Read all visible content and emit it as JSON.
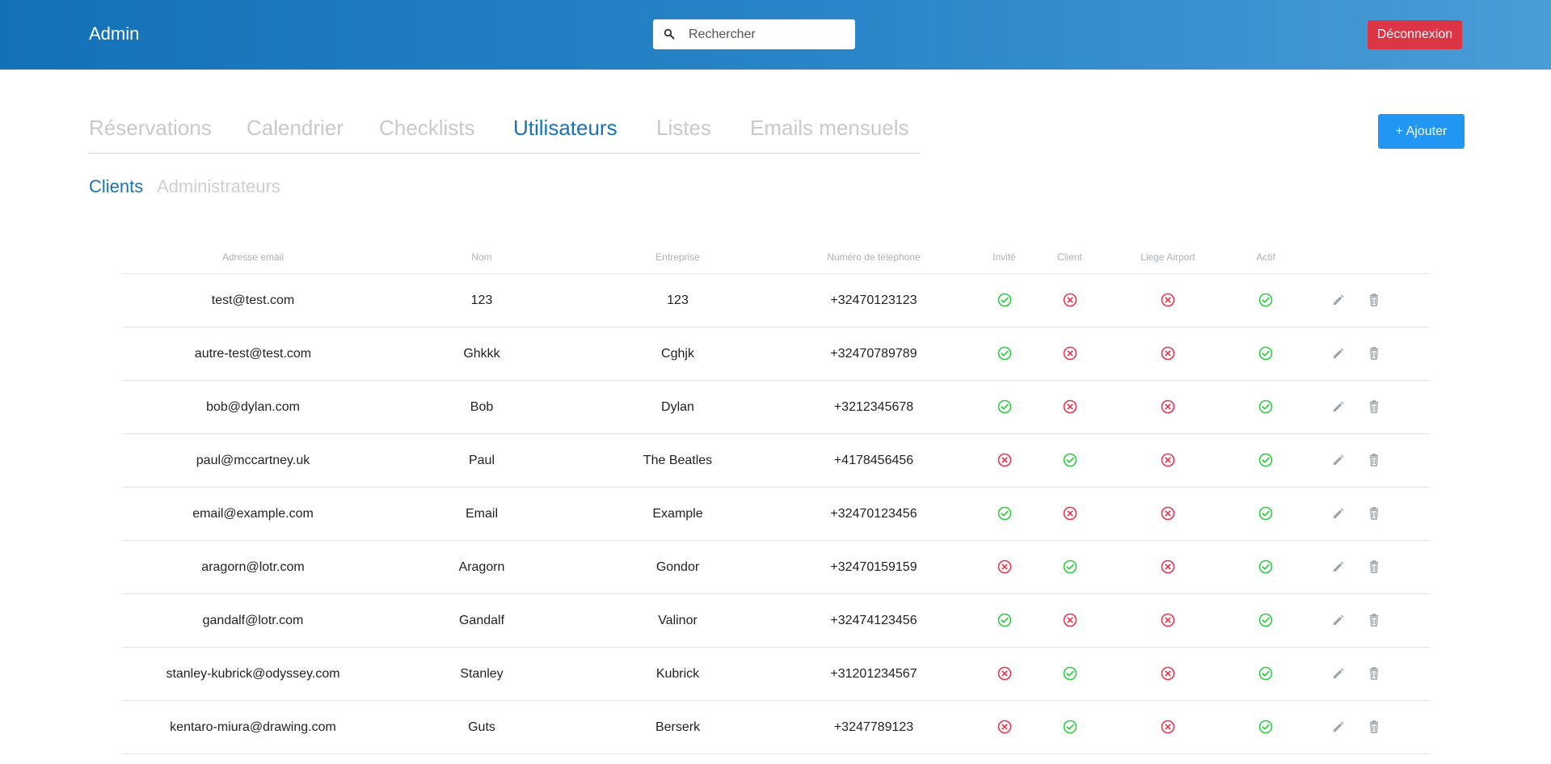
{
  "header": {
    "title": "Admin",
    "search_placeholder": "Rechercher",
    "search_value": "",
    "logout_label": "Déconnexion"
  },
  "tabs": [
    {
      "label": "Réservations",
      "active": false
    },
    {
      "label": "Calendrier",
      "active": false
    },
    {
      "label": "Checklists",
      "active": false
    },
    {
      "label": "Utilisateurs",
      "active": true
    },
    {
      "label": "Listes",
      "active": false
    },
    {
      "label": "Emails mensuels",
      "active": false
    }
  ],
  "add_button": {
    "label": "+ Ajouter"
  },
  "subtabs": [
    {
      "label": "Clients",
      "active": true
    },
    {
      "label": "Administrateurs",
      "active": false
    }
  ],
  "colors": {
    "accent": "#1a73b7",
    "check": "#2ecc40",
    "cross": "#e8344e",
    "danger": "#dc3545",
    "primary": "#2196f3"
  },
  "icons": {
    "yes": "check-circle-icon",
    "no": "x-circle-icon",
    "edit": "pencil-icon",
    "delete": "trash-icon",
    "search": "search-icon"
  },
  "table": {
    "columns": [
      "Adresse email",
      "Nom",
      "Entreprise",
      "Numéro de téléphone",
      "Invité",
      "Client",
      "Liege Airport",
      "Actif"
    ],
    "rows": [
      {
        "email": "test@test.com",
        "nom": "123",
        "entreprise": "123",
        "telephone": "+32470123123",
        "invite": true,
        "client": false,
        "liege_airport": false,
        "actif": true
      },
      {
        "email": "autre-test@test.com",
        "nom": "Ghkkk",
        "entreprise": "Cghjk",
        "telephone": "+32470789789",
        "invite": true,
        "client": false,
        "liege_airport": false,
        "actif": true
      },
      {
        "email": "bob@dylan.com",
        "nom": "Bob",
        "entreprise": "Dylan",
        "telephone": "+3212345678",
        "invite": true,
        "client": false,
        "liege_airport": false,
        "actif": true
      },
      {
        "email": "paul@mccartney.uk",
        "nom": "Paul",
        "entreprise": "The Beatles",
        "telephone": "+4178456456",
        "invite": false,
        "client": true,
        "liege_airport": false,
        "actif": true
      },
      {
        "email": "email@example.com",
        "nom": "Email",
        "entreprise": "Example",
        "telephone": "+32470123456",
        "invite": true,
        "client": false,
        "liege_airport": false,
        "actif": true
      },
      {
        "email": "aragorn@lotr.com",
        "nom": "Aragorn",
        "entreprise": "Gondor",
        "telephone": "+32470159159",
        "invite": false,
        "client": true,
        "liege_airport": false,
        "actif": true
      },
      {
        "email": "gandalf@lotr.com",
        "nom": "Gandalf",
        "entreprise": "Valinor",
        "telephone": "+32474123456",
        "invite": true,
        "client": false,
        "liege_airport": false,
        "actif": true
      },
      {
        "email": "stanley-kubrick@odyssey.com",
        "nom": "Stanley",
        "entreprise": "Kubrick",
        "telephone": "+31201234567",
        "invite": false,
        "client": true,
        "liege_airport": false,
        "actif": true
      },
      {
        "email": "kentaro-miura@drawing.com",
        "nom": "Guts",
        "entreprise": "Berserk",
        "telephone": "+3247789123",
        "invite": false,
        "client": true,
        "liege_airport": false,
        "actif": true
      }
    ]
  }
}
